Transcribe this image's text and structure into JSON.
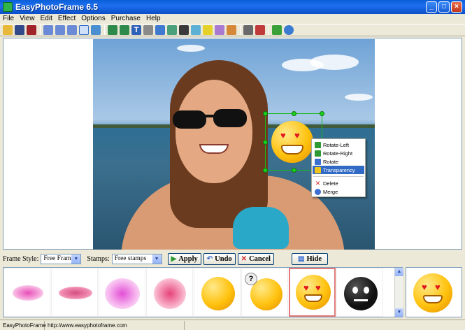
{
  "window": {
    "title": "EasyPhotoFrame 6.5"
  },
  "menu": [
    "File",
    "View",
    "Edit",
    "Effect",
    "Options",
    "Purchase",
    "Help"
  ],
  "toolbar": {
    "icons": [
      "open-folder-icon",
      "save-icon",
      "save-as-icon",
      "zoom-icon",
      "zoom-in-icon",
      "zoom-out-icon",
      "select-icon",
      "fit-icon",
      "crop-icon",
      "resize-icon",
      "text-icon",
      "frame-icon",
      "rotate-icon",
      "flip-icon",
      "brightness-icon",
      "color-icon",
      "red-eye-icon",
      "levels-icon",
      "histogram-icon",
      "print-icon",
      "print-preview-icon",
      "undo-icon",
      "web-icon"
    ]
  },
  "context_menu": {
    "items": [
      {
        "label": "Rotate-Left",
        "color": "#2f9a33"
      },
      {
        "label": "Rotate-Right",
        "color": "#2f9a33"
      },
      {
        "label": "Rotate",
        "color": "#3d6fd0"
      },
      {
        "label": "Transparency",
        "color": "#f0c419",
        "active": true
      },
      {
        "label": "Delete",
        "color": "#d22a2a"
      },
      {
        "label": "Merge",
        "color": "#3d6fd0"
      }
    ]
  },
  "controls": {
    "frame_style_label": "Frame Style:",
    "frame_style_value": "Free Frames",
    "stamps_label": "Stamps:",
    "stamps_value": "Free stamps",
    "apply_label": "Apply",
    "undo_label": "Undo",
    "cancel_label": "Cancel",
    "hide_label": "Hide"
  },
  "status": {
    "app": "EasyPhotoFrame",
    "url": "http://www.easyphotoframe.com"
  },
  "colors": {
    "accent": "#316ac5",
    "selection": "#1ed11e"
  }
}
